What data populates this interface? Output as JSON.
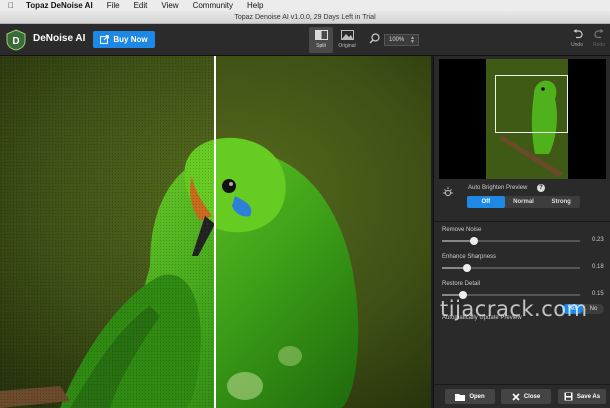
{
  "menubar": {
    "app_name": "Topaz DeNoise AI",
    "items": [
      "File",
      "Edit",
      "View",
      "Community",
      "Help"
    ]
  },
  "window": {
    "title": "Topaz Denoise AI v1.0.0, 29 Days Left in Trial"
  },
  "toolbar": {
    "app_title": "DeNoise AI",
    "buy_label": "Buy Now",
    "split_label": "Split",
    "original_label": "Original",
    "zoom_value": "100%",
    "undo_label": "Undo",
    "redo_label": "Redo"
  },
  "panel": {
    "auto_brighten_label": "Auto Brighten Preview",
    "brighten_options": [
      "Off",
      "Normal",
      "Strong"
    ],
    "brighten_selected": "Off",
    "sliders": [
      {
        "label": "Remove Noise",
        "value": "0.23",
        "level": 0.23
      },
      {
        "label": "Enhance Sharpness",
        "value": "0.18",
        "level": 0.18
      },
      {
        "label": "Restore Detail",
        "value": "0.15",
        "level": 0.15
      }
    ],
    "auto_update_label": "Automatically Update Preview",
    "auto_update_yes": "Yes",
    "auto_update_no": "No",
    "open_label": "Open",
    "close_label": "Close",
    "save_label": "Save As"
  },
  "watermark": "tijacrack.com",
  "colors": {
    "accent": "#1e88e5",
    "panel_bg": "#2a2a2a"
  }
}
